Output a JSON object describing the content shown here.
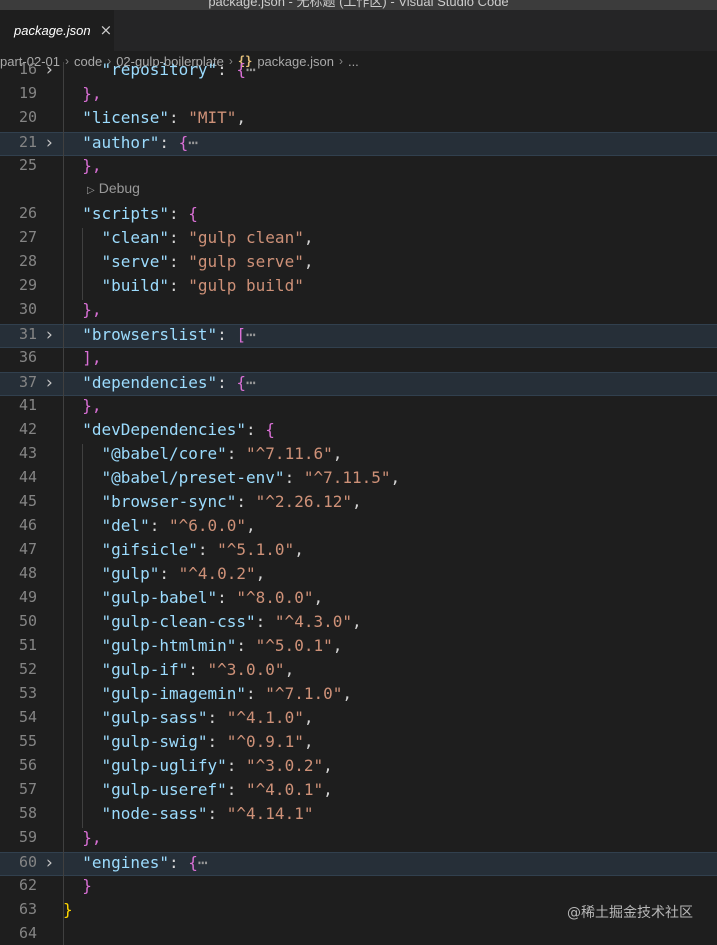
{
  "window": {
    "title": "package.json - 无标题 (工作区) - Visual Studio Code"
  },
  "tab": {
    "label": "package.json",
    "close": "×"
  },
  "breadcrumb": {
    "items": [
      "part-02-01",
      "code",
      "02-gulp-boilerplate"
    ],
    "file": "package.json",
    "more": "...",
    "separator": "›",
    "braces": "{}"
  },
  "codelens": {
    "label": "Debug"
  },
  "watermark": "@稀土掘金技术社区",
  "colors": {
    "key": "#9cdcfe",
    "string": "#ce9178",
    "bracket_level1": "#ffd700",
    "bracket_level2": "#da70d6",
    "background": "#1e1e1e",
    "folded_line": "#262f38"
  },
  "lines": [
    {
      "n": "16",
      "fold": true,
      "partial": true,
      "parts": [
        [
          "    ",
          "p"
        ],
        [
          "\"repository\"",
          "k"
        ],
        [
          ": ",
          "p"
        ],
        [
          "{",
          "b"
        ],
        [
          "⋯",
          "e"
        ]
      ]
    },
    {
      "n": "19",
      "parts": [
        [
          "  ",
          "p"
        ],
        [
          "},",
          "b"
        ]
      ]
    },
    {
      "n": "20",
      "parts": [
        [
          "  ",
          "p"
        ],
        [
          "\"license\"",
          "k"
        ],
        [
          ": ",
          "p"
        ],
        [
          "\"MIT\"",
          "s"
        ],
        [
          ",",
          "p"
        ]
      ]
    },
    {
      "n": "21",
      "fold": true,
      "folded": true,
      "parts": [
        [
          "  ",
          "p"
        ],
        [
          "\"author\"",
          "k"
        ],
        [
          ": ",
          "p"
        ],
        [
          "{",
          "b"
        ],
        [
          "⋯",
          "e"
        ]
      ]
    },
    {
      "n": "25",
      "parts": [
        [
          "  ",
          "p"
        ],
        [
          "},",
          "b"
        ]
      ]
    },
    {
      "codelens": true
    },
    {
      "n": "26",
      "parts": [
        [
          "  ",
          "p"
        ],
        [
          "\"scripts\"",
          "k"
        ],
        [
          ": ",
          "p"
        ],
        [
          "{",
          "b"
        ]
      ]
    },
    {
      "n": "27",
      "parts": [
        [
          "    ",
          "p"
        ],
        [
          "\"clean\"",
          "k"
        ],
        [
          ": ",
          "p"
        ],
        [
          "\"gulp clean\"",
          "s"
        ],
        [
          ",",
          "p"
        ]
      ]
    },
    {
      "n": "28",
      "parts": [
        [
          "    ",
          "p"
        ],
        [
          "\"serve\"",
          "k"
        ],
        [
          ": ",
          "p"
        ],
        [
          "\"gulp serve\"",
          "s"
        ],
        [
          ",",
          "p"
        ]
      ]
    },
    {
      "n": "29",
      "parts": [
        [
          "    ",
          "p"
        ],
        [
          "\"build\"",
          "k"
        ],
        [
          ": ",
          "p"
        ],
        [
          "\"gulp build\"",
          "s"
        ]
      ]
    },
    {
      "n": "30",
      "parts": [
        [
          "  ",
          "p"
        ],
        [
          "},",
          "b"
        ]
      ]
    },
    {
      "n": "31",
      "fold": true,
      "folded": true,
      "parts": [
        [
          "  ",
          "p"
        ],
        [
          "\"browserslist\"",
          "k"
        ],
        [
          ": ",
          "p"
        ],
        [
          "[",
          "b"
        ],
        [
          "⋯",
          "e"
        ]
      ]
    },
    {
      "n": "36",
      "parts": [
        [
          "  ",
          "p"
        ],
        [
          "],",
          "b"
        ]
      ]
    },
    {
      "n": "37",
      "fold": true,
      "folded": true,
      "parts": [
        [
          "  ",
          "p"
        ],
        [
          "\"dependencies\"",
          "k"
        ],
        [
          ": ",
          "p"
        ],
        [
          "{",
          "b"
        ],
        [
          "⋯",
          "e"
        ]
      ]
    },
    {
      "n": "41",
      "parts": [
        [
          "  ",
          "p"
        ],
        [
          "},",
          "b"
        ]
      ]
    },
    {
      "n": "42",
      "parts": [
        [
          "  ",
          "p"
        ],
        [
          "\"devDependencies\"",
          "k"
        ],
        [
          ": ",
          "p"
        ],
        [
          "{",
          "b"
        ]
      ]
    },
    {
      "n": "43",
      "parts": [
        [
          "    ",
          "p"
        ],
        [
          "\"@babel/core\"",
          "k"
        ],
        [
          ": ",
          "p"
        ],
        [
          "\"^7.11.6\"",
          "s"
        ],
        [
          ",",
          "p"
        ]
      ]
    },
    {
      "n": "44",
      "parts": [
        [
          "    ",
          "p"
        ],
        [
          "\"@babel/preset-env\"",
          "k"
        ],
        [
          ": ",
          "p"
        ],
        [
          "\"^7.11.5\"",
          "s"
        ],
        [
          ",",
          "p"
        ]
      ]
    },
    {
      "n": "45",
      "parts": [
        [
          "    ",
          "p"
        ],
        [
          "\"browser-sync\"",
          "k"
        ],
        [
          ": ",
          "p"
        ],
        [
          "\"^2.26.12\"",
          "s"
        ],
        [
          ",",
          "p"
        ]
      ]
    },
    {
      "n": "46",
      "parts": [
        [
          "    ",
          "p"
        ],
        [
          "\"del\"",
          "k"
        ],
        [
          ": ",
          "p"
        ],
        [
          "\"^6.0.0\"",
          "s"
        ],
        [
          ",",
          "p"
        ]
      ]
    },
    {
      "n": "47",
      "parts": [
        [
          "    ",
          "p"
        ],
        [
          "\"gifsicle\"",
          "k"
        ],
        [
          ": ",
          "p"
        ],
        [
          "\"^5.1.0\"",
          "s"
        ],
        [
          ",",
          "p"
        ]
      ]
    },
    {
      "n": "48",
      "parts": [
        [
          "    ",
          "p"
        ],
        [
          "\"gulp\"",
          "k"
        ],
        [
          ": ",
          "p"
        ],
        [
          "\"^4.0.2\"",
          "s"
        ],
        [
          ",",
          "p"
        ]
      ]
    },
    {
      "n": "49",
      "parts": [
        [
          "    ",
          "p"
        ],
        [
          "\"gulp-babel\"",
          "k"
        ],
        [
          ": ",
          "p"
        ],
        [
          "\"^8.0.0\"",
          "s"
        ],
        [
          ",",
          "p"
        ]
      ]
    },
    {
      "n": "50",
      "parts": [
        [
          "    ",
          "p"
        ],
        [
          "\"gulp-clean-css\"",
          "k"
        ],
        [
          ": ",
          "p"
        ],
        [
          "\"^4.3.0\"",
          "s"
        ],
        [
          ",",
          "p"
        ]
      ]
    },
    {
      "n": "51",
      "parts": [
        [
          "    ",
          "p"
        ],
        [
          "\"gulp-htmlmin\"",
          "k"
        ],
        [
          ": ",
          "p"
        ],
        [
          "\"^5.0.1\"",
          "s"
        ],
        [
          ",",
          "p"
        ]
      ]
    },
    {
      "n": "52",
      "parts": [
        [
          "    ",
          "p"
        ],
        [
          "\"gulp-if\"",
          "k"
        ],
        [
          ": ",
          "p"
        ],
        [
          "\"^3.0.0\"",
          "s"
        ],
        [
          ",",
          "p"
        ]
      ]
    },
    {
      "n": "53",
      "parts": [
        [
          "    ",
          "p"
        ],
        [
          "\"gulp-imagemin\"",
          "k"
        ],
        [
          ": ",
          "p"
        ],
        [
          "\"^7.1.0\"",
          "s"
        ],
        [
          ",",
          "p"
        ]
      ]
    },
    {
      "n": "54",
      "parts": [
        [
          "    ",
          "p"
        ],
        [
          "\"gulp-sass\"",
          "k"
        ],
        [
          ": ",
          "p"
        ],
        [
          "\"^4.1.0\"",
          "s"
        ],
        [
          ",",
          "p"
        ]
      ]
    },
    {
      "n": "55",
      "parts": [
        [
          "    ",
          "p"
        ],
        [
          "\"gulp-swig\"",
          "k"
        ],
        [
          ": ",
          "p"
        ],
        [
          "\"^0.9.1\"",
          "s"
        ],
        [
          ",",
          "p"
        ]
      ]
    },
    {
      "n": "56",
      "parts": [
        [
          "    ",
          "p"
        ],
        [
          "\"gulp-uglify\"",
          "k"
        ],
        [
          ": ",
          "p"
        ],
        [
          "\"^3.0.2\"",
          "s"
        ],
        [
          ",",
          "p"
        ]
      ]
    },
    {
      "n": "57",
      "parts": [
        [
          "    ",
          "p"
        ],
        [
          "\"gulp-useref\"",
          "k"
        ],
        [
          ": ",
          "p"
        ],
        [
          "\"^4.0.1\"",
          "s"
        ],
        [
          ",",
          "p"
        ]
      ]
    },
    {
      "n": "58",
      "parts": [
        [
          "    ",
          "p"
        ],
        [
          "\"node-sass\"",
          "k"
        ],
        [
          ": ",
          "p"
        ],
        [
          "\"^4.14.1\"",
          "s"
        ]
      ]
    },
    {
      "n": "59",
      "parts": [
        [
          "  ",
          "p"
        ],
        [
          "},",
          "b"
        ]
      ]
    },
    {
      "n": "60",
      "fold": true,
      "folded": true,
      "parts": [
        [
          "  ",
          "p"
        ],
        [
          "\"engines\"",
          "k"
        ],
        [
          ": ",
          "p"
        ],
        [
          "{",
          "b"
        ],
        [
          "⋯",
          "e"
        ]
      ]
    },
    {
      "n": "62",
      "parts": [
        [
          "  ",
          "p"
        ],
        [
          "}",
          "b"
        ]
      ]
    },
    {
      "n": "63",
      "parts": [
        [
          "}",
          "y"
        ]
      ]
    },
    {
      "n": "64",
      "parts": []
    }
  ]
}
